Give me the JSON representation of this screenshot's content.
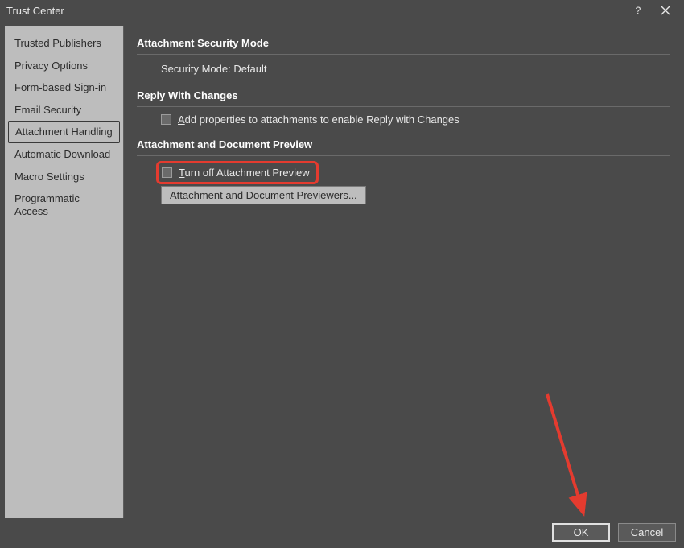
{
  "title": "Trust Center",
  "sidebar": {
    "items": [
      {
        "label": "Trusted Publishers"
      },
      {
        "label": "Privacy Options"
      },
      {
        "label": "Form-based Sign-in"
      },
      {
        "label": "Email Security"
      },
      {
        "label": "Attachment Handling"
      },
      {
        "label": "Automatic Download"
      },
      {
        "label": "Macro Settings"
      },
      {
        "label": "Programmatic Access"
      }
    ],
    "selected_index": 4
  },
  "sections": {
    "attachment_security": {
      "title": "Attachment Security Mode",
      "mode_line": "Security Mode: Default"
    },
    "reply_with_changes": {
      "title": "Reply With Changes",
      "checkbox_label_prefix": "A",
      "checkbox_label_rest": "dd properties to attachments to enable Reply with Changes"
    },
    "attachment_preview": {
      "title": "Attachment and Document Preview",
      "turnoff_prefix": "T",
      "turnoff_rest": "urn off Attachment Preview",
      "previewers_btn_prefix": "Attachment and Document ",
      "previewers_btn_u": "P",
      "previewers_btn_rest": "reviewers..."
    }
  },
  "footer": {
    "ok": "OK",
    "cancel": "Cancel"
  }
}
